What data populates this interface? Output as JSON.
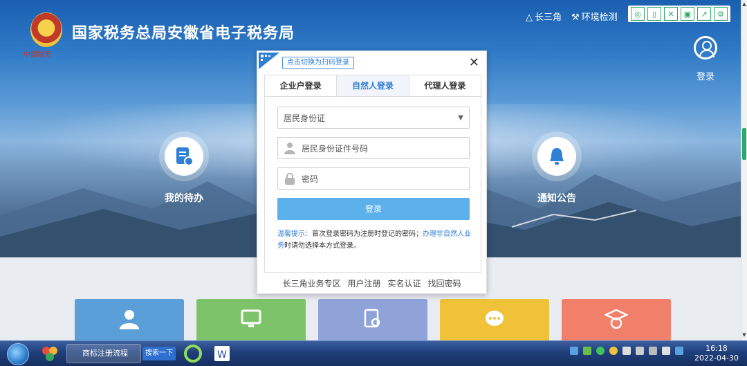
{
  "header": {
    "logo_caption": "中国税务",
    "site_title": "国家税务总局安徽省电子税务局",
    "links": [
      {
        "icon": "triangle-icon",
        "label": "长三角"
      },
      {
        "icon": "wrench-icon",
        "label": "环境检测"
      }
    ],
    "toolbar_icons": [
      "search-icon",
      "page-icon",
      "expand-icon",
      "save-icon",
      "export-icon",
      "gear-icon"
    ],
    "login_label": "登录"
  },
  "hero": {
    "left_card": {
      "label": "我的待办",
      "icon": "task-list-icon"
    },
    "right_card": {
      "label": "通知公告",
      "icon": "bell-icon"
    }
  },
  "tiles": [
    {
      "icon": "user-icon",
      "color": "#5a9fd8"
    },
    {
      "icon": "monitor-icon",
      "color": "#7cc36a"
    },
    {
      "icon": "document-search-icon",
      "color": "#8fa3d9"
    },
    {
      "icon": "chat-icon",
      "color": "#f0c23a"
    },
    {
      "icon": "graduate-icon",
      "color": "#f0806a"
    }
  ],
  "modal": {
    "qr_tip": "点击切换为扫码登录",
    "close_symbol": "✕",
    "tabs": [
      {
        "label": "企业户登录",
        "active": false
      },
      {
        "label": "自然人登录",
        "active": true
      },
      {
        "label": "代理人登录",
        "active": false
      }
    ],
    "id_type_selected": "居民身份证",
    "id_number_placeholder": "居民身份证件号码",
    "password_placeholder": "密码",
    "login_button": "登录",
    "tip_prefix": "温馨提示：",
    "tip_body": "首次登录密码为注册时登记的密码；",
    "tip_link": "办理非自然人业务",
    "tip_suffix": "时请勿选择本方式登录。",
    "footer_links": [
      "长三角业务专区",
      "用户注册",
      "实名认证",
      "找回密码"
    ]
  },
  "taskbar": {
    "ie_window_label": "商标注册流程及...",
    "search_button": "搜索一下",
    "clock_time": "16:18",
    "clock_date": "2022-04-30"
  },
  "colors": {
    "accent_blue": "#2f7fd4",
    "login_button": "#5cb0ec",
    "toolbar_green": "#2fa86a"
  }
}
